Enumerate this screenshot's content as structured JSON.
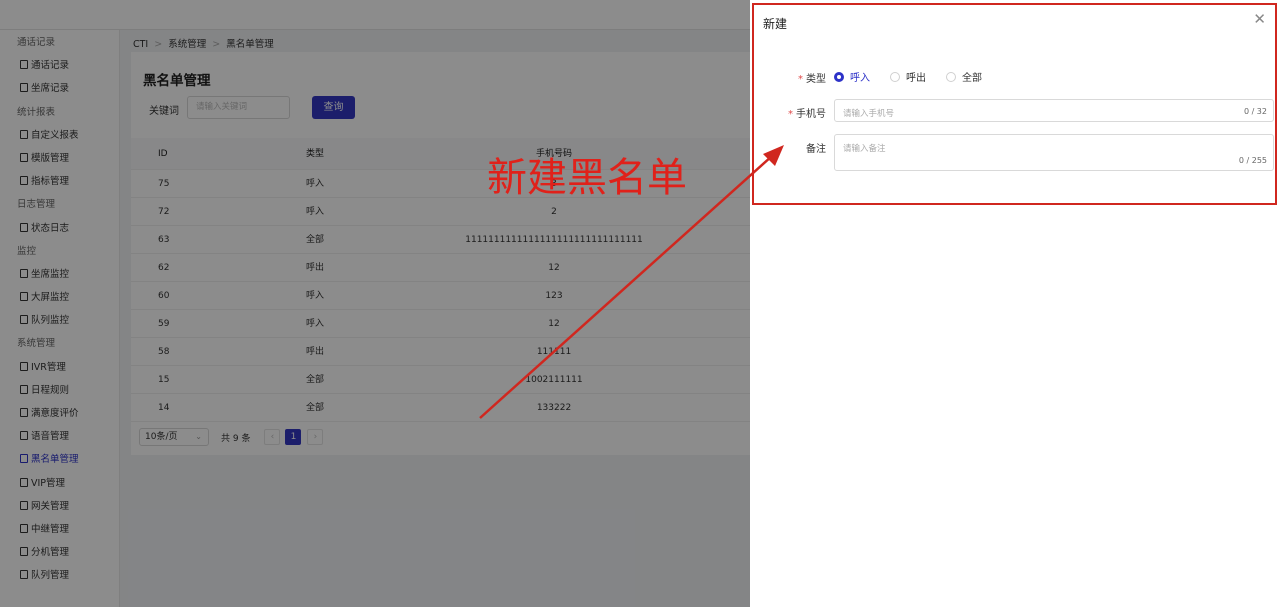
{
  "breadcrumb": [
    "CTI",
    "系统管理",
    "黑名单管理"
  ],
  "sidebar": [
    {
      "type": "group",
      "label": "通话记录"
    },
    {
      "type": "link",
      "label": "通话记录"
    },
    {
      "type": "link",
      "label": "坐席记录"
    },
    {
      "type": "group",
      "label": "统计报表"
    },
    {
      "type": "link",
      "label": "自定义报表"
    },
    {
      "type": "link",
      "label": "模版管理"
    },
    {
      "type": "link",
      "label": "指标管理"
    },
    {
      "type": "group",
      "label": "日志管理"
    },
    {
      "type": "link",
      "label": "状态日志"
    },
    {
      "type": "group",
      "label": "监控"
    },
    {
      "type": "link",
      "label": "坐席监控"
    },
    {
      "type": "link",
      "label": "大屏监控"
    },
    {
      "type": "link",
      "label": "队列监控"
    },
    {
      "type": "group",
      "label": "系统管理"
    },
    {
      "type": "link",
      "label": "IVR管理"
    },
    {
      "type": "link",
      "label": "日程规则"
    },
    {
      "type": "link",
      "label": "满意度评价"
    },
    {
      "type": "link",
      "label": "语音管理"
    },
    {
      "type": "link",
      "label": "黑名单管理",
      "active": true
    },
    {
      "type": "link",
      "label": "VIP管理"
    },
    {
      "type": "link",
      "label": "网关管理"
    },
    {
      "type": "link",
      "label": "中继管理"
    },
    {
      "type": "link",
      "label": "分机管理"
    },
    {
      "type": "link",
      "label": "队列管理"
    }
  ],
  "page": {
    "title": "黑名单管理",
    "keyword_label": "关键词",
    "keyword_placeholder": "请输入关键词",
    "query_button": "查询"
  },
  "table": {
    "headers": [
      "ID",
      "类型",
      "手机号码"
    ],
    "rows": [
      [
        "75",
        "呼入",
        "3"
      ],
      [
        "72",
        "呼入",
        "2"
      ],
      [
        "63",
        "全部",
        "1111111111111111111111111111111"
      ],
      [
        "62",
        "呼出",
        "12"
      ],
      [
        "60",
        "呼入",
        "123"
      ],
      [
        "59",
        "呼入",
        "12"
      ],
      [
        "58",
        "呼出",
        "111111"
      ],
      [
        "15",
        "全部",
        "1002111111"
      ],
      [
        "14",
        "全部",
        "133222"
      ]
    ]
  },
  "pager": {
    "page_size": "10条/页",
    "total": "共 9 条",
    "current_page": "1"
  },
  "drawer": {
    "title": "新建",
    "type_label": "类型",
    "type_options": [
      "呼入",
      "呼出",
      "全部"
    ],
    "type_selected": 0,
    "phone_label": "手机号",
    "phone_placeholder": "请输入手机号",
    "phone_count": "0 / 32",
    "note_label": "备注",
    "note_placeholder": "请输入备注",
    "note_count": "0 / 255"
  },
  "annotation": {
    "text": "新建黑名单",
    "color": "#e0211a"
  },
  "colors": {
    "primary": "#2d32c8",
    "annotation": "#d0271f"
  }
}
